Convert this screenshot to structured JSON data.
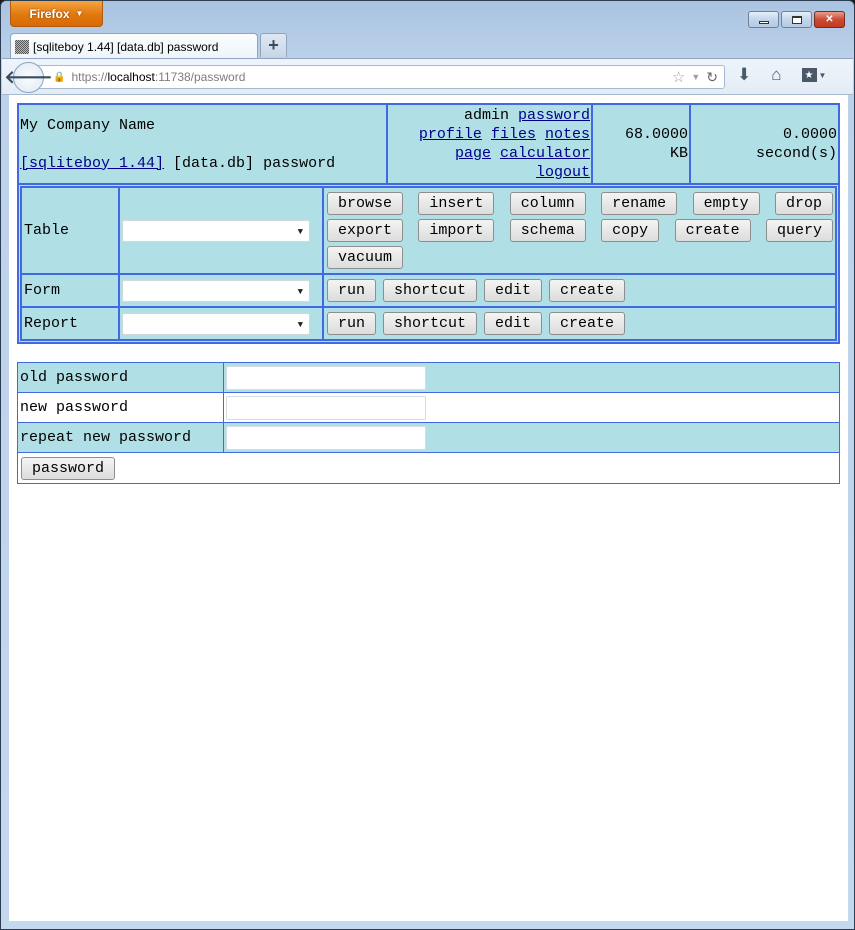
{
  "browser": {
    "menu_button": "Firefox",
    "tab_title": "[sqliteboy 1.44] [data.db] password",
    "new_tab_label": "+",
    "url": {
      "scheme": "https://",
      "host": "localhost",
      "rest": ":11738/password"
    },
    "icons": {
      "back": "back-arrow-icon",
      "lock": "lock-icon",
      "bookmark_star": "star-icon",
      "history_dropdown": "dropdown-icon",
      "reload": "reload-icon",
      "downloads": "download-icon",
      "home": "home-icon",
      "bookmarks_menu": "bookmarks-icon"
    }
  },
  "header": {
    "company_name": "My Company Name",
    "app_link": "[sqliteboy 1.44]",
    "db_name": "[data.db]",
    "page_name": "password",
    "user": "admin",
    "links": {
      "password": "password",
      "profile": "profile",
      "files": "files",
      "notes": "notes",
      "page": "page",
      "calculator": "calculator",
      "logout": "logout"
    },
    "db_size_value": "68.0000",
    "db_size_unit": "KB",
    "time_value": "0.0000",
    "time_unit": "second(s)"
  },
  "nav": {
    "table": {
      "label": "Table",
      "selected": "",
      "buttons_row1": [
        "browse",
        "insert",
        "column",
        "rename",
        "empty",
        "drop"
      ],
      "buttons_row2": [
        "export",
        "import",
        "schema",
        "copy",
        "create",
        "query"
      ],
      "buttons_row3": [
        "vacuum"
      ]
    },
    "form": {
      "label": "Form",
      "selected": "",
      "buttons": [
        "run",
        "shortcut",
        "edit",
        "create"
      ]
    },
    "report": {
      "label": "Report",
      "selected": "",
      "buttons": [
        "run",
        "shortcut",
        "edit",
        "create"
      ]
    }
  },
  "password_form": {
    "old_label": "old password",
    "old_value": "",
    "new_label": "new password",
    "new_value": "",
    "repeat_label": "repeat new password",
    "repeat_value": "",
    "submit_label": "password"
  },
  "colors": {
    "accent_border": "#4169e1",
    "row_bg": "#b0e0e6",
    "link": "#00008b"
  }
}
